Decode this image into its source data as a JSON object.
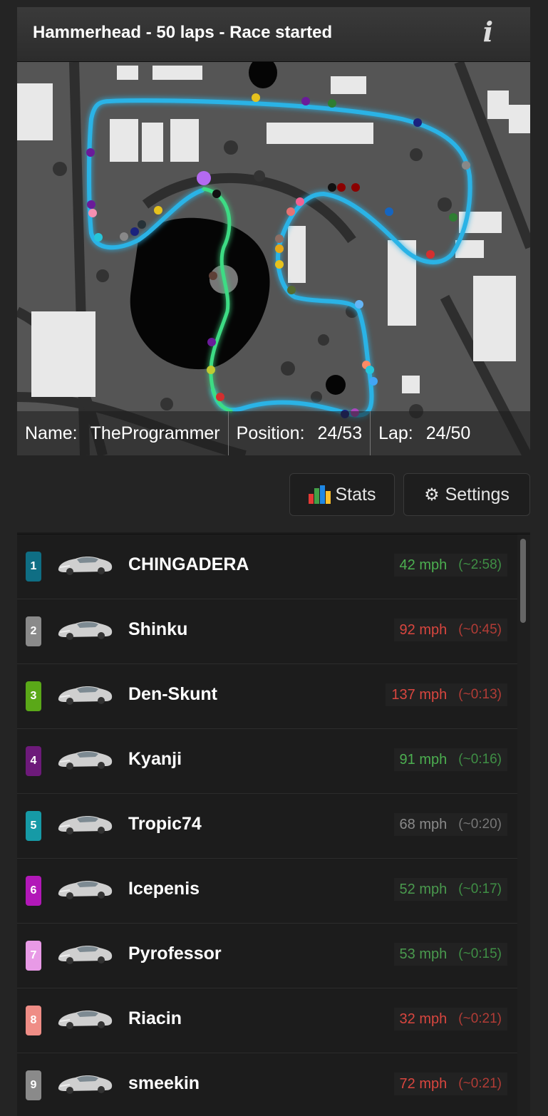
{
  "header": {
    "title": "Hammerhead - 50 laps - Race started",
    "info_icon": "i"
  },
  "infobar": {
    "name_label": "Name:",
    "name_value": "TheProgrammer",
    "position_label": "Position:",
    "position_value": "24/53",
    "lap_label": "Lap:",
    "lap_value": "24/50"
  },
  "toolbar": {
    "stats_label": "Stats",
    "settings_label": "Settings",
    "stats_icon": "bar-chart-icon",
    "settings_icon": "gear-icon"
  },
  "colors": {
    "speed_fast_red": "#d9463f",
    "speed_green": "#4caf50",
    "speed_gray": "#8a8a8a",
    "track_blue": "#2bb3e6",
    "track_green": "#3ddc84"
  },
  "racers": [
    {
      "pos": "1",
      "name": "CHINGADERA",
      "speed": "42 mph",
      "eta": "(~2:58)",
      "badge": "#0f6e84",
      "speed_color": "#4caf50",
      "eta_color": "#3f8f45"
    },
    {
      "pos": "2",
      "name": "Shinku",
      "speed": "92 mph",
      "eta": "(~0:45)",
      "badge": "#8a8a8a",
      "speed_color": "#d9463f",
      "eta_color": "#b23c36"
    },
    {
      "pos": "3",
      "name": "Den-Skunt",
      "speed": "137 mph",
      "eta": "(~0:13)",
      "badge": "#5aa818",
      "speed_color": "#d9463f",
      "eta_color": "#b23c36"
    },
    {
      "pos": "4",
      "name": "Kyanji",
      "speed": "91 mph",
      "eta": "(~0:16)",
      "badge": "#6d1a7a",
      "speed_color": "#4caf50",
      "eta_color": "#3f8f45"
    },
    {
      "pos": "5",
      "name": "Tropic74",
      "speed": "68 mph",
      "eta": "(~0:20)",
      "badge": "#169aa6",
      "speed_color": "#8a8a8a",
      "eta_color": "#777777"
    },
    {
      "pos": "6",
      "name": "Icepenis",
      "speed": "52 mph",
      "eta": "(~0:17)",
      "badge": "#b218b8",
      "speed_color": "#4a9a4e",
      "eta_color": "#3f8f45"
    },
    {
      "pos": "7",
      "name": "Pyrofessor",
      "speed": "53 mph",
      "eta": "(~0:15)",
      "badge": "#e89ae6",
      "speed_color": "#4a9a4e",
      "eta_color": "#3f8f45"
    },
    {
      "pos": "8",
      "name": "Riacin",
      "speed": "32 mph",
      "eta": "(~0:21)",
      "badge": "#ef8d86",
      "speed_color": "#d9463f",
      "eta_color": "#b23c36"
    },
    {
      "pos": "9",
      "name": "smeekin",
      "speed": "72 mph",
      "eta": "(~0:21)",
      "badge": "#8a8a8a",
      "speed_color": "#d9463f",
      "eta_color": "#b23c36"
    }
  ]
}
